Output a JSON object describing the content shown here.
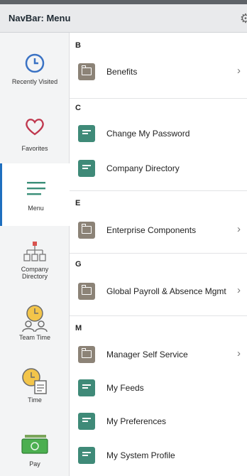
{
  "header": {
    "title": "NavBar: Menu"
  },
  "sidebar": {
    "items": [
      {
        "label": "Recently Visited"
      },
      {
        "label": "Favorites"
      },
      {
        "label": "Menu"
      },
      {
        "label": "Company Directory"
      },
      {
        "label": "Team Time"
      },
      {
        "label": "Time"
      },
      {
        "label": "Pay"
      }
    ]
  },
  "menu": {
    "sections": [
      {
        "letter": "B",
        "items": [
          {
            "label": "Benefits"
          }
        ]
      },
      {
        "letter": "C",
        "items": [
          {
            "label": "Change My Password"
          },
          {
            "label": "Company Directory"
          }
        ]
      },
      {
        "letter": "E",
        "items": [
          {
            "label": "Enterprise Components"
          }
        ]
      },
      {
        "letter": "G",
        "items": [
          {
            "label": "Global Payroll & Absence Mgmt"
          }
        ]
      },
      {
        "letter": "M",
        "items": [
          {
            "label": "Manager Self Service"
          },
          {
            "label": "My Feeds"
          },
          {
            "label": "My Preferences"
          },
          {
            "label": "My System Profile"
          }
        ]
      }
    ]
  },
  "colors": {
    "folder_tile": "#8c8377",
    "page_tile": "#3f8a78",
    "active_accent": "#1f6fbf"
  }
}
